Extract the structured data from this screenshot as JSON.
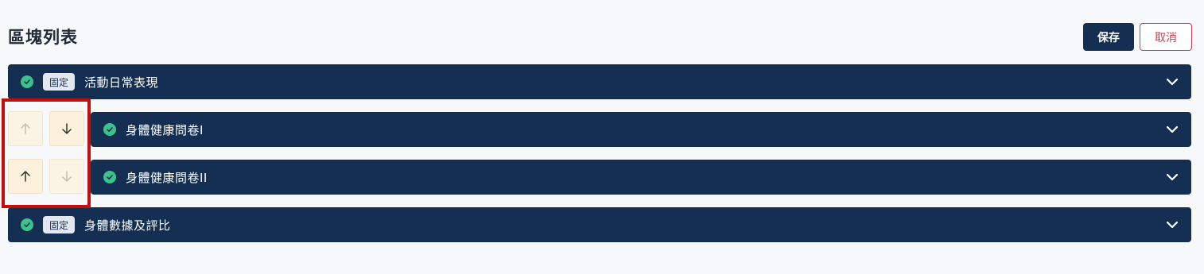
{
  "header": {
    "title": "區塊列表",
    "save_label": "保存",
    "cancel_label": "取消"
  },
  "blocks": [
    {
      "title": "活動日常表現",
      "badge": "固定",
      "status": "check"
    },
    {
      "title": "身體健康問卷I",
      "badge": "",
      "status": "check"
    },
    {
      "title": "身體健康問卷II",
      "badge": "",
      "status": "check"
    },
    {
      "title": "身體數據及評比",
      "badge": "固定",
      "status": "check"
    }
  ],
  "reorder_controls": [
    {
      "row": "身體健康問卷I",
      "up_enabled": false,
      "down_enabled": true
    },
    {
      "row": "身體健康問卷II",
      "up_enabled": true,
      "down_enabled": false
    }
  ],
  "colors": {
    "block_bg": "#142f52",
    "success": "#3cc28a",
    "cancel": "#d23a4b",
    "highlight": "#c40d0d",
    "arrow_bg": "#fbf1dc"
  },
  "icons": {
    "status": "check-circle-icon",
    "expand": "chevron-down-icon",
    "move_up": "arrow-up-icon",
    "move_down": "arrow-down-icon"
  }
}
